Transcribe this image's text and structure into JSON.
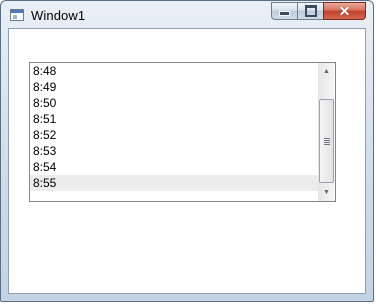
{
  "window": {
    "title": "Window1",
    "icon": "window-app-icon"
  },
  "caption_buttons": {
    "minimize": "minimize-icon",
    "maximize": "maximize-icon",
    "close": "close-icon"
  },
  "listbox": {
    "items": [
      "8:48",
      "8:49",
      "8:50",
      "8:51",
      "8:52",
      "8:53",
      "8:54",
      "8:55"
    ],
    "selected_item": "8:55"
  },
  "scrollbar": {
    "up_arrow": "▲",
    "down_arrow": "▼"
  }
}
